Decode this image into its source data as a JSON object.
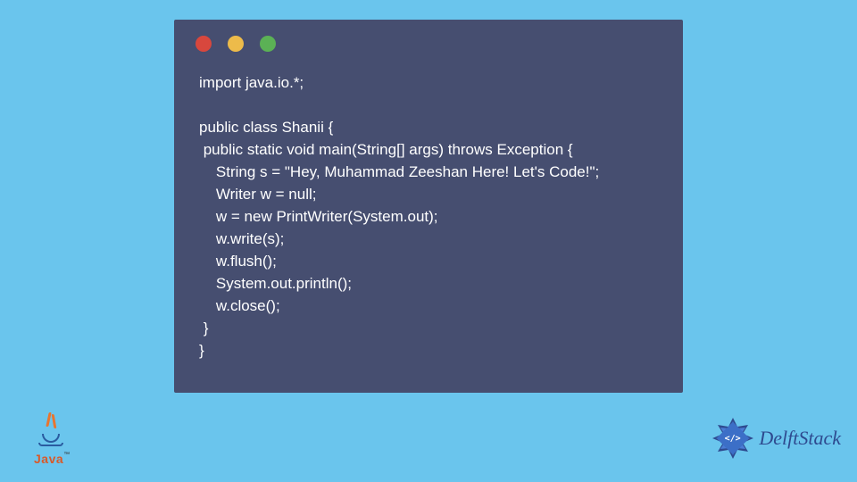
{
  "code": {
    "line1": "import java.io.*;",
    "line2": "",
    "line3": "public class Shanii {",
    "line4": " public static void main(String[] args) throws Exception {",
    "line5": "    String s = \"Hey, Muhammad Zeeshan Here! Let's Code!\";",
    "line6": "    Writer w = null;",
    "line7": "    w = new PrintWriter(System.out);",
    "line8": "    w.write(s);",
    "line9": "    w.flush();",
    "line10": "    System.out.println();",
    "line11": "    w.close();",
    "line12": " }",
    "line13": "}"
  },
  "logos": {
    "java_label": "Java",
    "java_tm": "™",
    "delft_label": "DelftStack",
    "delft_code": "</>"
  }
}
